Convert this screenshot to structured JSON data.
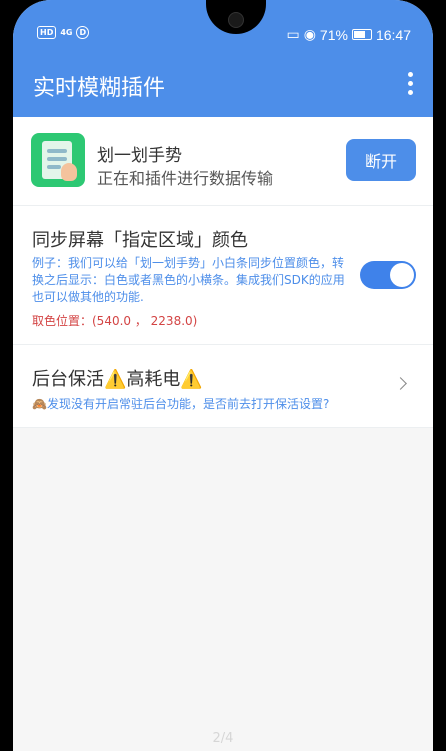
{
  "status_bar": {
    "left": {
      "hd": "HD",
      "signal": "4G",
      "tag": "D"
    },
    "battery_pct": "71%",
    "time": "16:47"
  },
  "app_bar": {
    "title": "实时模糊插件",
    "menu_icon": "more-vert-icon"
  },
  "plugin": {
    "name": "划一划手势",
    "status": "正在和插件进行数据传输",
    "button": "断开"
  },
  "sync_color": {
    "title": "同步屏幕「指定区域」颜色",
    "description": "例子：我们可以给「划一划手势」小白条同步位置颜色，转换之后显示：白色或者黑色的小横条。集成我们SDK的应用也可以做其他的功能.",
    "coordinates": "取色位置：(540.0 ， 2238.0)",
    "toggle_on": true
  },
  "background_keep": {
    "title": "后台保活⚠️高耗电⚠️",
    "description": "🙈发现没有开启常驻后台功能，是否前去打开保活设置?"
  },
  "page_indicator": "2/4",
  "colors": {
    "primary": "#4d8ee9",
    "coord_red": "#d34444",
    "plugin_green": "#2dc873"
  }
}
